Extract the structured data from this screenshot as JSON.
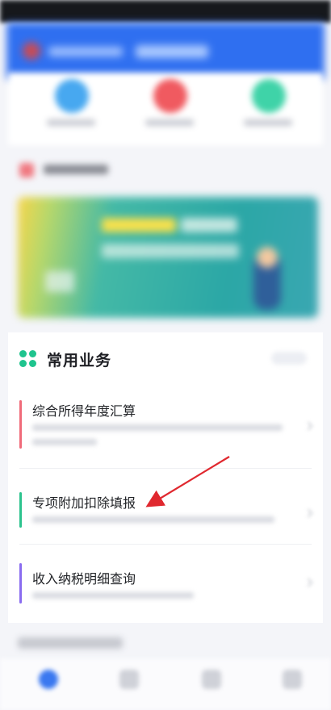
{
  "business": {
    "title": "常用业务",
    "items": [
      {
        "label": "综合所得年度汇算",
        "accent": "#f06b7a"
      },
      {
        "label": "专项附加扣除填报",
        "accent": "#2cc38e"
      },
      {
        "label": "收入纳税明细查询",
        "accent": "#8a6cf0"
      }
    ]
  },
  "colors": {
    "header_blue": "#2f6ff0",
    "clover_green": "#1fc48e",
    "annotation_arrow": "#e0282f"
  },
  "icons": [
    "clover-icon",
    "chevron-right-icon",
    "home-tab-icon"
  ]
}
